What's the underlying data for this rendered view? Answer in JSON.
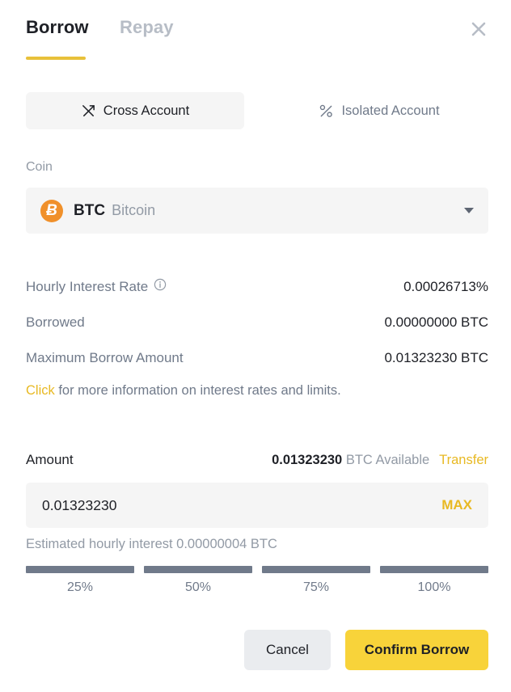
{
  "dialog": {
    "tabs": [
      {
        "label": "Borrow",
        "active": true
      },
      {
        "label": "Repay",
        "active": false
      }
    ],
    "close_icon": "close-icon"
  },
  "account_modes": [
    {
      "label": "Cross Account",
      "icon": "cross-arrows-icon",
      "selected": true
    },
    {
      "label": "Isolated Account",
      "icon": "isolated-percent-icon",
      "selected": false
    }
  ],
  "coin": {
    "label": "Coin",
    "symbol": "BTC",
    "name": "Bitcoin",
    "icon": "bitcoin-icon",
    "icon_glyph": "Ƀ",
    "icon_color": "#f0902a",
    "caret_icon": "chevron-down-icon"
  },
  "info": {
    "rows": [
      {
        "label": "Hourly Interest Rate",
        "value": "0.00026713%",
        "has_info_icon": true
      },
      {
        "label": "Borrowed",
        "value": "0.00000000 BTC",
        "has_info_icon": false
      },
      {
        "label": "Maximum Borrow Amount",
        "value": "0.01323230 BTC",
        "has_info_icon": false
      }
    ],
    "hint_link": "Click",
    "hint_rest": " for more information on interest rates and limits."
  },
  "amount": {
    "title": "Amount",
    "available_value": "0.01323230",
    "available_suffix": " BTC Available",
    "transfer_label": "Transfer",
    "input_value": "0.01323230",
    "input_placeholder": "0.00000000",
    "max_label": "MAX",
    "estimated_interest": "Estimated hourly interest 0.00000004 BTC"
  },
  "slider": {
    "segments": [
      {
        "label": "25%",
        "filled": true
      },
      {
        "label": "50%",
        "filled": true
      },
      {
        "label": "75%",
        "filled": true
      },
      {
        "label": "100%",
        "filled": true
      }
    ]
  },
  "footer": {
    "cancel_label": "Cancel",
    "confirm_label": "Confirm Borrow"
  },
  "colors": {
    "accent_yellow": "#f8d33a",
    "link_yellow": "#e8b923",
    "tab_underline": "#e8c13a",
    "field_bg": "#f5f5f5",
    "muted_text": "#929aa5",
    "label_text": "#707a8a",
    "primary_text": "#1e2026",
    "bitcoin_orange": "#f0902a",
    "slider_fill": "#707a8a"
  }
}
